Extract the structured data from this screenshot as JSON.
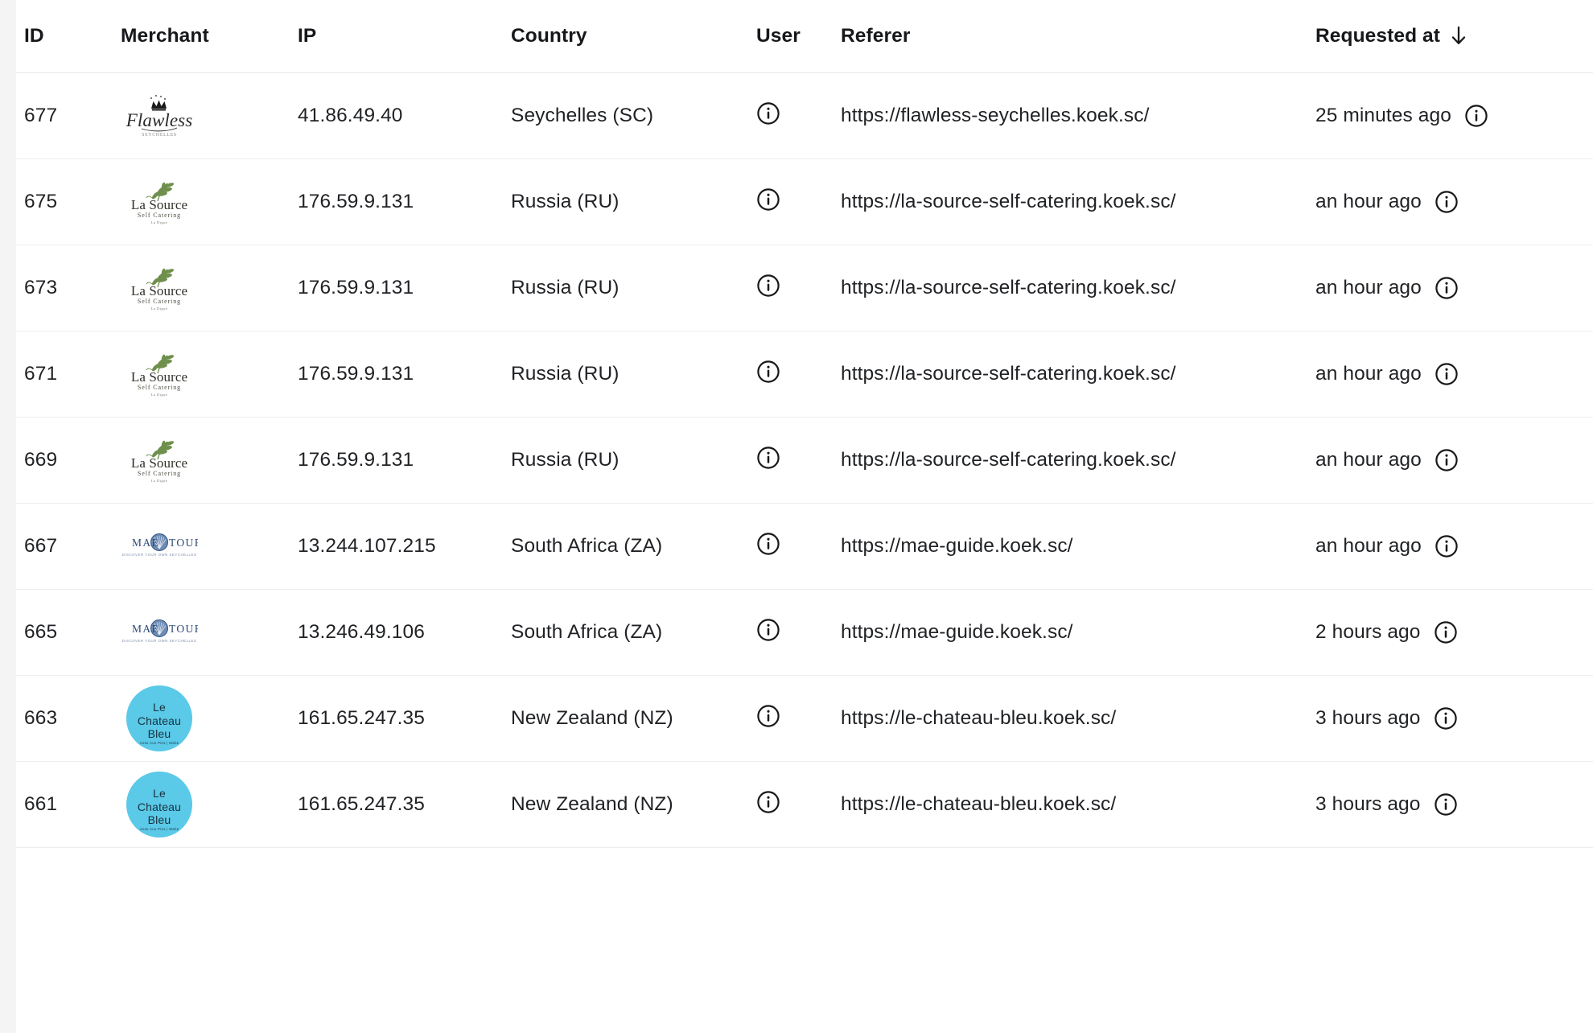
{
  "table": {
    "columns": [
      {
        "key": "id",
        "label": "ID"
      },
      {
        "key": "merchant",
        "label": "Merchant"
      },
      {
        "key": "ip",
        "label": "IP"
      },
      {
        "key": "country",
        "label": "Country"
      },
      {
        "key": "user",
        "label": "User"
      },
      {
        "key": "referer",
        "label": "Referer"
      },
      {
        "key": "requested",
        "label": "Requested at"
      }
    ],
    "sort": {
      "column": "Requested at",
      "direction": "desc",
      "icon": "arrow-down-icon"
    },
    "user_cell_icon": "info-icon",
    "requested_cell_icon": "info-icon",
    "rows": [
      {
        "id": "677",
        "merchant": {
          "name": "Flawless Seychelles",
          "logo": "flawless",
          "alt": "Flawless"
        },
        "ip": "41.86.49.40",
        "country": "Seychelles (SC)",
        "user": "",
        "referer": "https://flawless-seychelles.koek.sc/",
        "requested": "25 minutes ago"
      },
      {
        "id": "675",
        "merchant": {
          "name": "La Source Self Catering",
          "logo": "lasource",
          "alt": "La Source"
        },
        "ip": "176.59.9.131",
        "country": "Russia (RU)",
        "user": "",
        "referer": "https://la-source-self-catering.koek.sc/",
        "requested": "an hour ago"
      },
      {
        "id": "673",
        "merchant": {
          "name": "La Source Self Catering",
          "logo": "lasource",
          "alt": "La Source"
        },
        "ip": "176.59.9.131",
        "country": "Russia (RU)",
        "user": "",
        "referer": "https://la-source-self-catering.koek.sc/",
        "requested": "an hour ago"
      },
      {
        "id": "671",
        "merchant": {
          "name": "La Source Self Catering",
          "logo": "lasource",
          "alt": "La Source"
        },
        "ip": "176.59.9.131",
        "country": "Russia (RU)",
        "user": "",
        "referer": "https://la-source-self-catering.koek.sc/",
        "requested": "an hour ago"
      },
      {
        "id": "669",
        "merchant": {
          "name": "La Source Self Catering",
          "logo": "lasource",
          "alt": "La Source"
        },
        "ip": "176.59.9.131",
        "country": "Russia (RU)",
        "user": "",
        "referer": "https://la-source-self-catering.koek.sc/",
        "requested": "an hour ago"
      },
      {
        "id": "667",
        "merchant": {
          "name": "MAE TOURS",
          "logo": "maetours",
          "alt": "MAE TOURS"
        },
        "ip": "13.244.107.215",
        "country": "South Africa (ZA)",
        "user": "",
        "referer": "https://mae-guide.koek.sc/",
        "requested": "an hour ago"
      },
      {
        "id": "665",
        "merchant": {
          "name": "MAE TOURS",
          "logo": "maetours",
          "alt": "MAE TOURS"
        },
        "ip": "13.246.49.106",
        "country": "South Africa (ZA)",
        "user": "",
        "referer": "https://mae-guide.koek.sc/",
        "requested": "2 hours ago"
      },
      {
        "id": "663",
        "merchant": {
          "name": "Le Chateau Bleu",
          "logo": "chateaubleu",
          "alt": "Le Chateau Bleu"
        },
        "ip": "161.65.247.35",
        "country": "New Zealand (NZ)",
        "user": "",
        "referer": "https://le-chateau-bleu.koek.sc/",
        "requested": "3 hours ago"
      },
      {
        "id": "661",
        "merchant": {
          "name": "Le Chateau Bleu",
          "logo": "chateaubleu",
          "alt": "Le Chateau Bleu"
        },
        "ip": "161.65.247.35",
        "country": "New Zealand (NZ)",
        "user": "",
        "referer": "https://le-chateau-bleu.koek.sc/",
        "requested": "3 hours ago"
      }
    ]
  },
  "logos": {
    "flawless": {
      "word": "Flawless",
      "sub": "SEYCHELLES",
      "crown_color": "#1b1b1b"
    },
    "lasource": {
      "word": "La Source",
      "sub": "Self Catering",
      "sub2": "La Digue",
      "leaf_color": "#6f8f4d"
    },
    "maetours": {
      "word_left": "MAE",
      "word_right": "TOURS",
      "sub": "DISCOVER YOUR OWN SEYCHELLES",
      "shell_color": "#3c5f8f"
    },
    "chateaubleu": {
      "line1": "Le",
      "line2": "Chateau",
      "line3": "Bleu",
      "sub": "Anse Aux Pins | Mahe",
      "bg_color": "#5bc9e8"
    }
  },
  "colors": {
    "page_background": "#ffffff",
    "gutter": "#f4f4f5",
    "row_divider": "#eceded",
    "header_divider": "#e7e8ea",
    "text": "#1f2124",
    "header_text": "#16181b"
  }
}
